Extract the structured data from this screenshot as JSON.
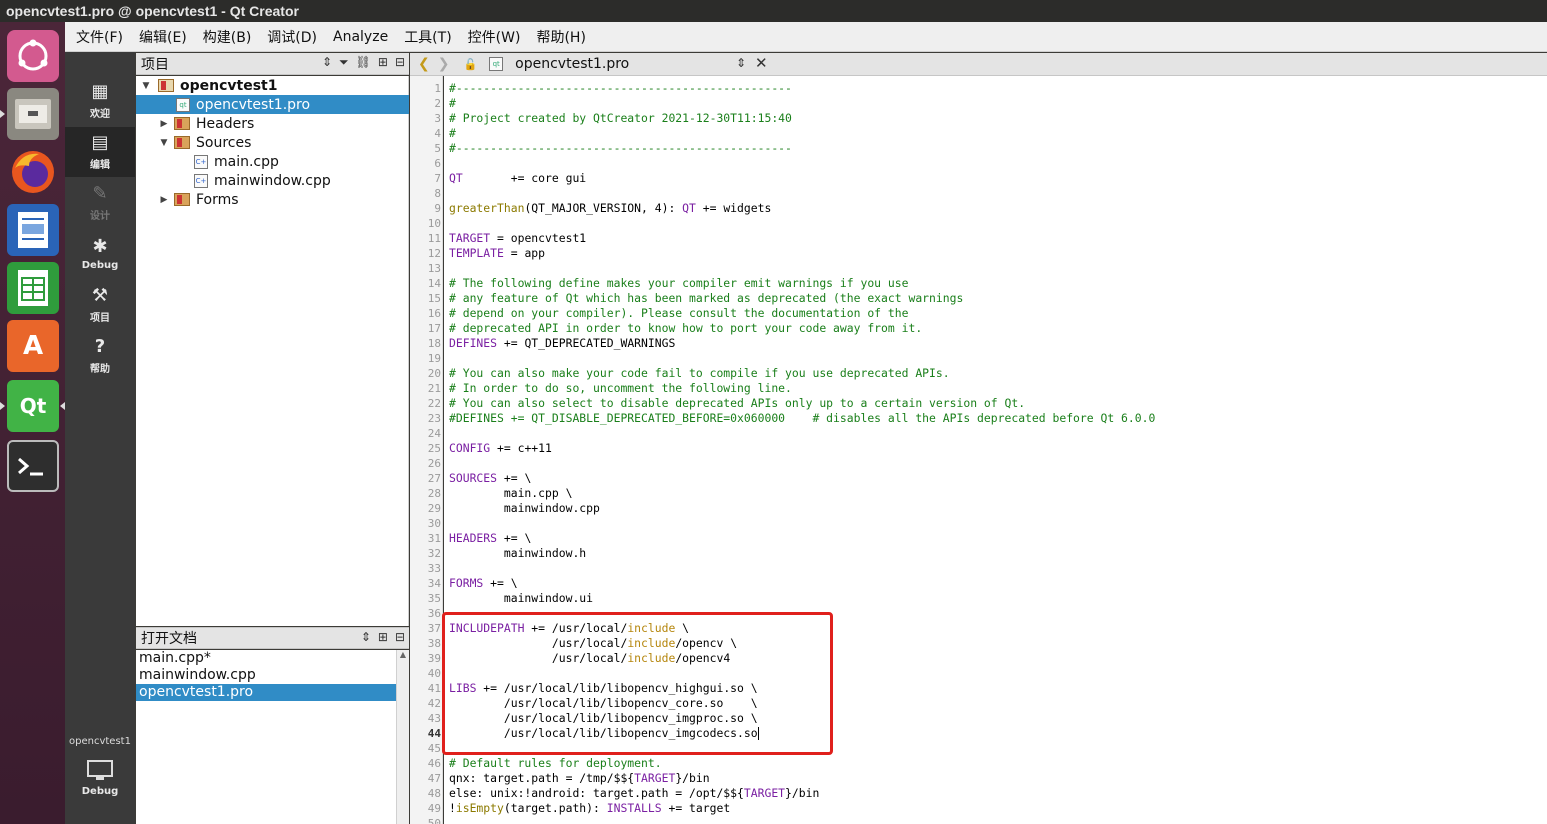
{
  "window_title": "opencvtest1.pro @ opencvtest1 - Qt Creator",
  "menu": [
    "文件(F)",
    "编辑(E)",
    "构建(B)",
    "调试(D)",
    "Analyze",
    "工具(T)",
    "控件(W)",
    "帮助(H)"
  ],
  "modes": [
    {
      "label": "欢迎",
      "icon": "welcome-grid-icon",
      "glyph": "▦"
    },
    {
      "label": "编辑",
      "icon": "edit-document-icon",
      "glyph": "▤"
    },
    {
      "label": "设计",
      "icon": "design-pen-icon",
      "glyph": "✎"
    },
    {
      "label": "Debug",
      "icon": "debug-bug-icon",
      "glyph": "✱"
    },
    {
      "label": "项目",
      "icon": "project-wrench-icon",
      "glyph": "⚒"
    },
    {
      "label": "帮助",
      "icon": "help-question-icon",
      "glyph": "?"
    }
  ],
  "kit": {
    "name": "opencvtest1",
    "build": "Debug"
  },
  "project_pane": {
    "title": "项目"
  },
  "tree": [
    {
      "label": "opencvtest1",
      "kind": "project",
      "bold": true
    },
    {
      "label": "opencvtest1.pro",
      "kind": "pro-file",
      "selected": true
    },
    {
      "label": "Headers",
      "kind": "folder"
    },
    {
      "label": "Sources",
      "kind": "folder"
    },
    {
      "label": "main.cpp",
      "kind": "cpp-file"
    },
    {
      "label": "mainwindow.cpp",
      "kind": "cpp-file"
    },
    {
      "label": "Forms",
      "kind": "folder"
    }
  ],
  "open_docs_pane": {
    "title": "打开文档"
  },
  "open_documents": [
    "main.cpp*",
    "mainwindow.cpp",
    "opencvtest1.pro"
  ],
  "editor": {
    "document": "opencvtest1.pro",
    "current_line": 44,
    "highlight_lines": [
      37,
      44
    ]
  },
  "code_lines": [
    "#-------------------------------------------------",
    "#",
    "# Project created by QtCreator 2021-12-30T11:15:40",
    "#",
    "#-------------------------------------------------",
    "",
    "QT       += core gui",
    "",
    "greaterThan(QT_MAJOR_VERSION, 4): QT += widgets",
    "",
    "TARGET = opencvtest1",
    "TEMPLATE = app",
    "",
    "# The following define makes your compiler emit warnings if you use",
    "# any feature of Qt which has been marked as deprecated (the exact warnings",
    "# depend on your compiler). Please consult the documentation of the",
    "# deprecated API in order to know how to port your code away from it.",
    "DEFINES += QT_DEPRECATED_WARNINGS",
    "",
    "# You can also make your code fail to compile if you use deprecated APIs.",
    "# In order to do so, uncomment the following line.",
    "# You can also select to disable deprecated APIs only up to a certain version of Qt.",
    "#DEFINES += QT_DISABLE_DEPRECATED_BEFORE=0x060000    # disables all the APIs deprecated before Qt 6.0.0",
    "",
    "CONFIG += c++11",
    "",
    "SOURCES += \\",
    "        main.cpp \\",
    "        mainwindow.cpp",
    "",
    "HEADERS += \\",
    "        mainwindow.h",
    "",
    "FORMS += \\",
    "        mainwindow.ui",
    "",
    "INCLUDEPATH += /usr/local/include \\",
    "               /usr/local/include/opencv \\",
    "               /usr/local/include/opencv4",
    "",
    "LIBS += /usr/local/lib/libopencv_highgui.so \\",
    "        /usr/local/lib/libopencv_core.so    \\",
    "        /usr/local/lib/libopencv_imgproc.so \\",
    "        /usr/local/lib/libopencv_imgcodecs.so",
    "",
    "# Default rules for deployment.",
    "qnx: target.path = /tmp/$${TARGET}/bin",
    "else: unix:!android: target.path = /opt/$${TARGET}/bin",
    "!isEmpty(target.path): INSTALLS += target",
    ""
  ],
  "colors": {
    "accent_selection": "#308cc6",
    "annotation_box": "#e0201c",
    "comment": "#1a7f1a",
    "keyword": "#7a1fa2"
  }
}
